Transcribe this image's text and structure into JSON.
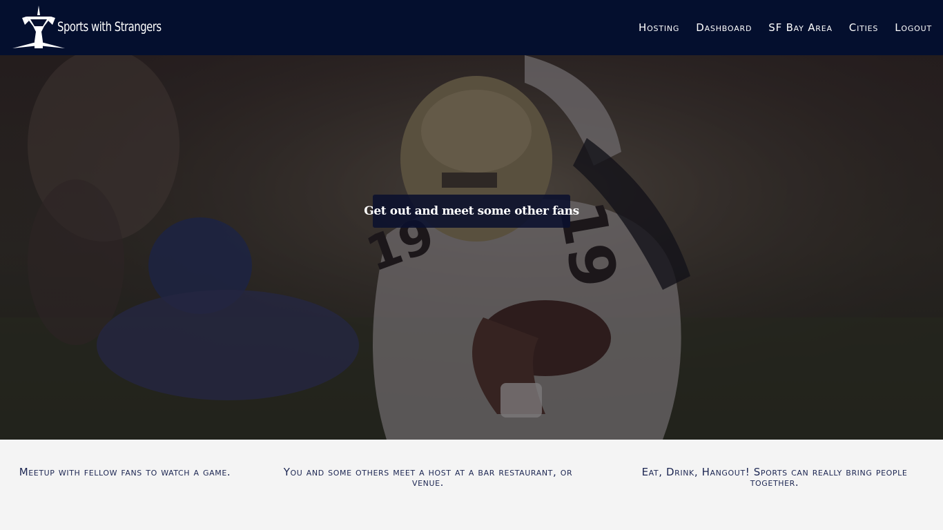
{
  "brand": {
    "name": "Sports with Strangers",
    "logo_icon": "trophy-icon"
  },
  "nav": {
    "items": [
      {
        "label": "Hosting"
      },
      {
        "label": "Dashboard"
      },
      {
        "label": "SF Bay Area"
      },
      {
        "label": "Cities"
      },
      {
        "label": "Logout"
      }
    ]
  },
  "hero": {
    "tagline": "Get out and meet some other fans"
  },
  "features": [
    {
      "text": "Meetup with fellow fans to watch a game."
    },
    {
      "text": "You and some others meet a host at a bar restaurant, or venue."
    },
    {
      "text": "Eat, Drink, Hangout! Sports can really bring people together."
    }
  ],
  "colors": {
    "navbar": "#040f2e",
    "tagline_bg": "#0a102e",
    "feature_text": "#1b2551",
    "page_bg": "#f4f4f4"
  }
}
